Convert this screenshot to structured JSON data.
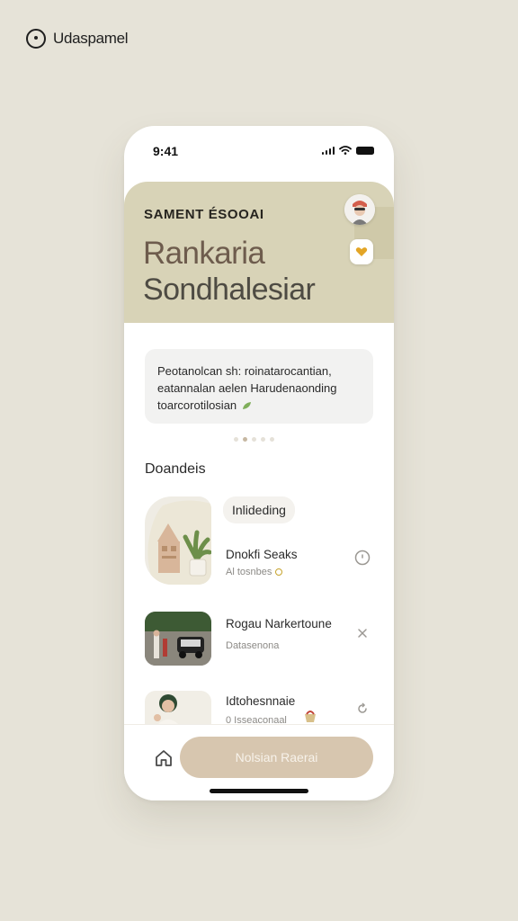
{
  "app": {
    "brand_name": "Udaspamel"
  },
  "status_bar": {
    "time": "9:41"
  },
  "hero": {
    "eyebrow": "SAMENT ÉSOOAI",
    "title_line1": "Rankaria",
    "title_line2": "Sondhalesiar"
  },
  "info_card": {
    "line1": "Peotanolcan sh: roinatarocantian,",
    "line2": "eatannalan aelen Harudenaonding",
    "line3": "toarcorotilosian"
  },
  "carousel": {
    "total": 5,
    "active": 1
  },
  "section": {
    "title": "Doandeis"
  },
  "list": {
    "items": [
      {
        "tag": "Inlideding",
        "title": "Dnokfi Seaks",
        "subtitle": "Al tosnbes"
      },
      {
        "title": "Rogau Narkertoune",
        "subtitle": "Datasenona"
      },
      {
        "title": "Idtohesnnaie",
        "subtitle": "0 Isseaconaal"
      }
    ]
  },
  "bottom_bar": {
    "cta_label": "Nolsian Raerai"
  },
  "colors": {
    "background": "#e6e3d8",
    "hero": "#d8d3b7",
    "accent": "#d7c6af",
    "title_brown": "#6e5c4d"
  }
}
